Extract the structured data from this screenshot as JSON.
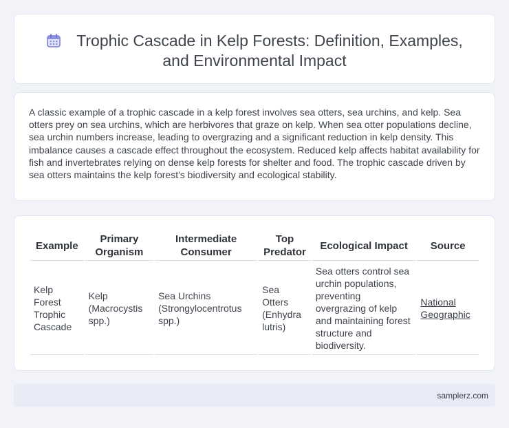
{
  "header": {
    "title": "Trophic Cascade in Kelp Forests: Definition, Examples, and Environmental Impact",
    "icon": "calendar-icon",
    "icon_color": "#7b7fd6"
  },
  "intro": {
    "text": "A classic example of a trophic cascade in a kelp forest involves sea otters, sea urchins, and kelp. Sea otters prey on sea urchins, which are herbivores that graze on kelp. When sea otter populations decline, sea urchin numbers increase, leading to overgrazing and a significant reduction in kelp density. This imbalance causes a cascade effect throughout the ecosystem. Reduced kelp affects habitat availability for fish and invertebrates relying on dense kelp forests for shelter and food. The trophic cascade driven by sea otters maintains the kelp forest's biodiversity and ecological stability."
  },
  "table": {
    "headers": [
      "Example",
      "Primary Organism",
      "Intermediate Consumer",
      "Top Predator",
      "Ecological Impact",
      "Source"
    ],
    "rows": [
      [
        "Kelp Forest Trophic Cascade",
        "Kelp (Macrocystis spp.)",
        "Sea Urchins (Strongylocentrotus spp.)",
        "Sea Otters (Enhydra lutris)",
        "Sea otters control sea urchin populations, preventing overgrazing of kelp and maintaining forest structure and biodiversity.",
        "National Geographic"
      ]
    ]
  },
  "footer": {
    "site": "samplerz.com"
  }
}
